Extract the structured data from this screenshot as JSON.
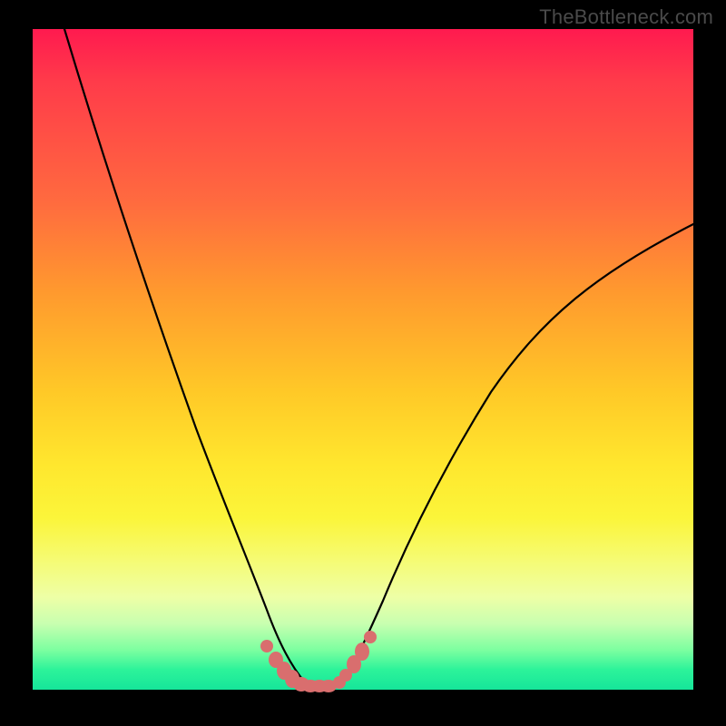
{
  "watermark": "TheBottleneck.com",
  "chart_data": {
    "type": "line",
    "title": "",
    "xlabel": "",
    "ylabel": "",
    "xlim": [
      0,
      100
    ],
    "ylim": [
      0,
      100
    ],
    "grid": false,
    "series": [
      {
        "name": "left-curve",
        "x": [
          5,
          8,
          11,
          14,
          17,
          20,
          23,
          26,
          28,
          30,
          32,
          34,
          36,
          37.5,
          39,
          40.5,
          42
        ],
        "values": [
          100,
          88,
          76,
          65,
          55,
          46,
          38,
          30,
          24,
          18,
          13,
          9,
          6,
          4,
          2.5,
          1.3,
          0.8
        ],
        "stroke": "#000000"
      },
      {
        "name": "right-curve",
        "x": [
          46,
          48,
          50,
          53,
          57,
          62,
          68,
          75,
          83,
          92,
          100
        ],
        "values": [
          0.8,
          2.2,
          5,
          10,
          17,
          26,
          36,
          46,
          55,
          63,
          70
        ],
        "stroke": "#000000"
      },
      {
        "name": "valley-markers",
        "type": "scatter",
        "x": [
          35.5,
          37,
          38,
          39.5,
          41,
          42.5,
          43.5,
          44.5,
          46,
          47,
          48.5,
          50,
          51
        ],
        "values": [
          6,
          4,
          2.8,
          1.7,
          1.0,
          0.7,
          0.6,
          0.6,
          0.7,
          1.1,
          2.0,
          3.4,
          5.2
        ],
        "marker_color": "#d96e6e"
      }
    ],
    "background_gradient": {
      "top": "#ff1a4f",
      "middle": "#ffd02a",
      "bottom": "#16e59a"
    }
  }
}
